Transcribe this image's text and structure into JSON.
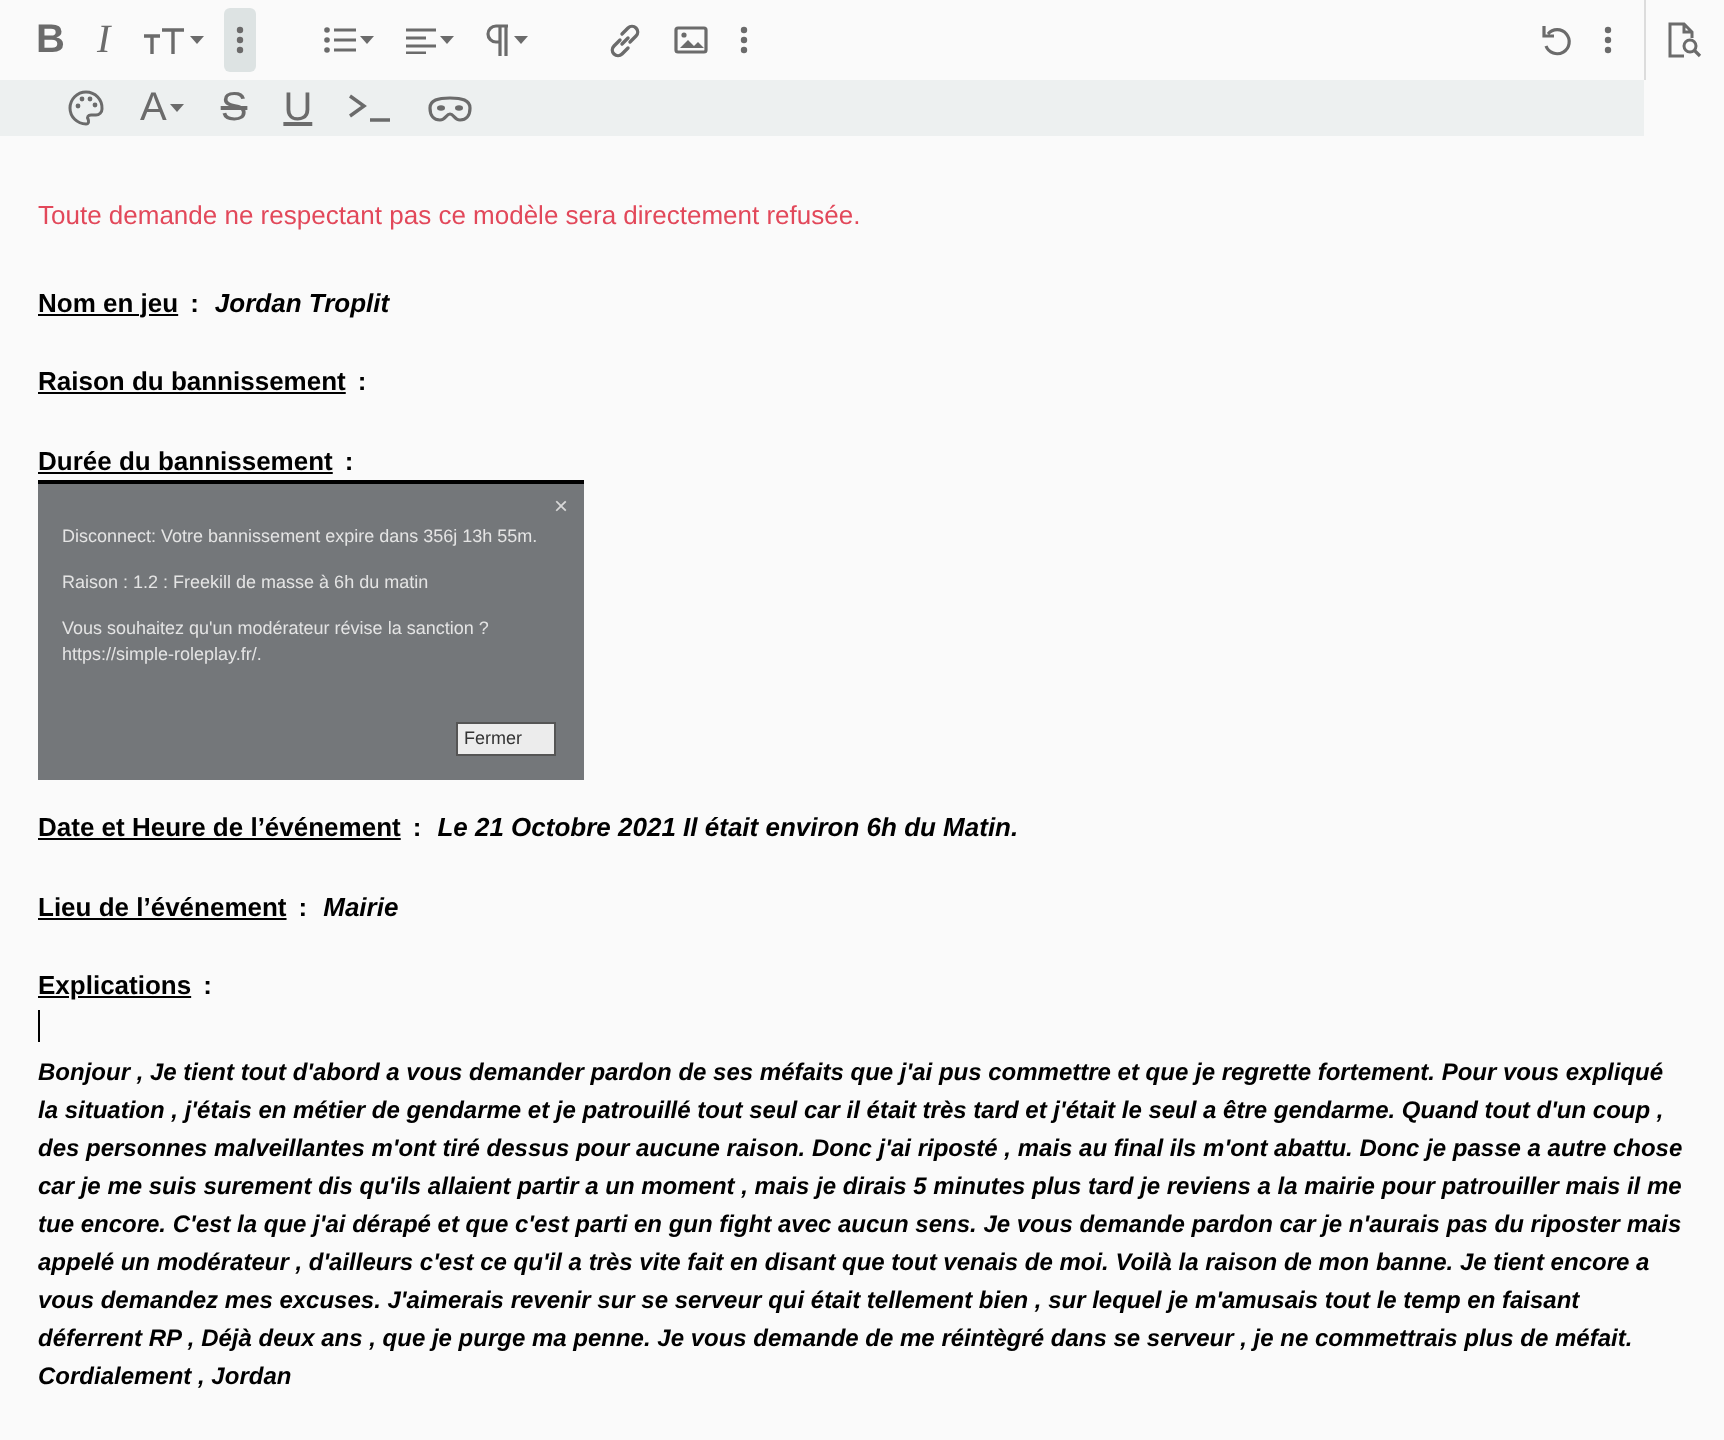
{
  "toolbar": {
    "rows": [
      [
        {
          "kind": "bold",
          "glyph": "B",
          "selected": false
        },
        {
          "kind": "italic",
          "glyph": "I",
          "selected": false
        },
        {
          "kind": "textsize",
          "dropdown": true,
          "selected": false
        },
        {
          "kind": "more",
          "selected": true
        },
        {
          "kind": "gap"
        },
        {
          "kind": "list",
          "dropdown": true,
          "selected": false
        },
        {
          "kind": "align",
          "dropdown": true,
          "selected": false
        },
        {
          "kind": "paragraph",
          "dropdown": true,
          "selected": false
        },
        {
          "kind": "gap"
        },
        {
          "kind": "link",
          "selected": false
        },
        {
          "kind": "image",
          "selected": false
        },
        {
          "kind": "more",
          "selected": false
        },
        {
          "kind": "spacer"
        },
        {
          "kind": "undo",
          "selected": false
        },
        {
          "kind": "more",
          "selected": false
        }
      ],
      [
        {
          "kind": "palette",
          "selected": false
        },
        {
          "kind": "textcolor",
          "glyph": "A",
          "dropdown": true,
          "selected": false
        },
        {
          "kind": "strike",
          "glyph": "S",
          "selected": false
        },
        {
          "kind": "underline",
          "glyph": "U",
          "selected": false
        },
        {
          "kind": "terminal",
          "selected": false
        },
        {
          "kind": "spoiler",
          "selected": false
        }
      ]
    ],
    "side": {
      "kind": "preview"
    }
  },
  "content": [
    {
      "kind": "notice",
      "text": "Toute demande ne respectant pas ce modèle sera directement refusée."
    },
    {
      "kind": "field",
      "label": "Nom en jeu ",
      "colon": ":",
      "value": "Jordan Troplit"
    },
    {
      "kind": "field",
      "label": "Raison du bannissement ",
      "colon": ":"
    },
    {
      "kind": "field",
      "label": "Durée du bannissement ",
      "colon": ":"
    },
    {
      "kind": "screenshot",
      "close": "×",
      "lines": [
        "Disconnect: Votre bannissement expire dans 356j 13h 55m.",
        "Raison : 1.2 : Freekill de masse à 6h du matin",
        "Vous souhaitez qu'un modérateur révise la sanction ? https://simple-roleplay.fr/."
      ],
      "button": "Fermer"
    },
    {
      "kind": "field",
      "label": "Date et Heure de l’événement ",
      "colon": ":",
      "value": "Le 21 Octobre 2021 Il était environ 6h du Matin."
    },
    {
      "kind": "field",
      "label": "Lieu de l’événement ",
      "colon": ":",
      "value": "Mairie"
    },
    {
      "kind": "field",
      "label": "Explications ",
      "colon": ":"
    },
    {
      "kind": "caret"
    },
    {
      "kind": "paragraph",
      "text": "Bonjour , Je tient tout d'abord a vous demander pardon de ses méfaits que j'ai pus commettre et que je regrette fortement. Pour vous expliqué la situation , j'étais en métier de gendarme et je patrouillé tout seul car il était très tard et j'était le seul a être gendarme. Quand tout d'un coup , des personnes malveillantes m'ont tiré dessus pour aucune raison. Donc j'ai riposté , mais au final ils m'ont abattu. Donc je passe a autre chose car je me suis surement dis qu'ils allaient partir a un moment , mais je dirais 5 minutes plus tard je reviens a la mairie pour patrouiller mais il me tue encore. C'est la que j'ai dérapé et que c'est parti en gun fight avec aucun sens. Je vous demande pardon car je n'aurais pas du riposter mais appelé un modérateur , d'ailleurs c'est ce qu'il a très vite fait en disant que tout venais de moi. Voilà la raison de mon banne. Je tient encore a vous demandez mes excuses. J'aimerais revenir sur se serveur qui était tellement bien , sur lequel je m'amusais tout le temp en faisant déferrent RP , Déjà deux ans , que je purge ma penne. Je vous demande de me réintègré dans se serveur , je ne commettrais plus de méfait."
    },
    {
      "kind": "paragraph",
      "text": "Cordialement , Jordan"
    }
  ]
}
